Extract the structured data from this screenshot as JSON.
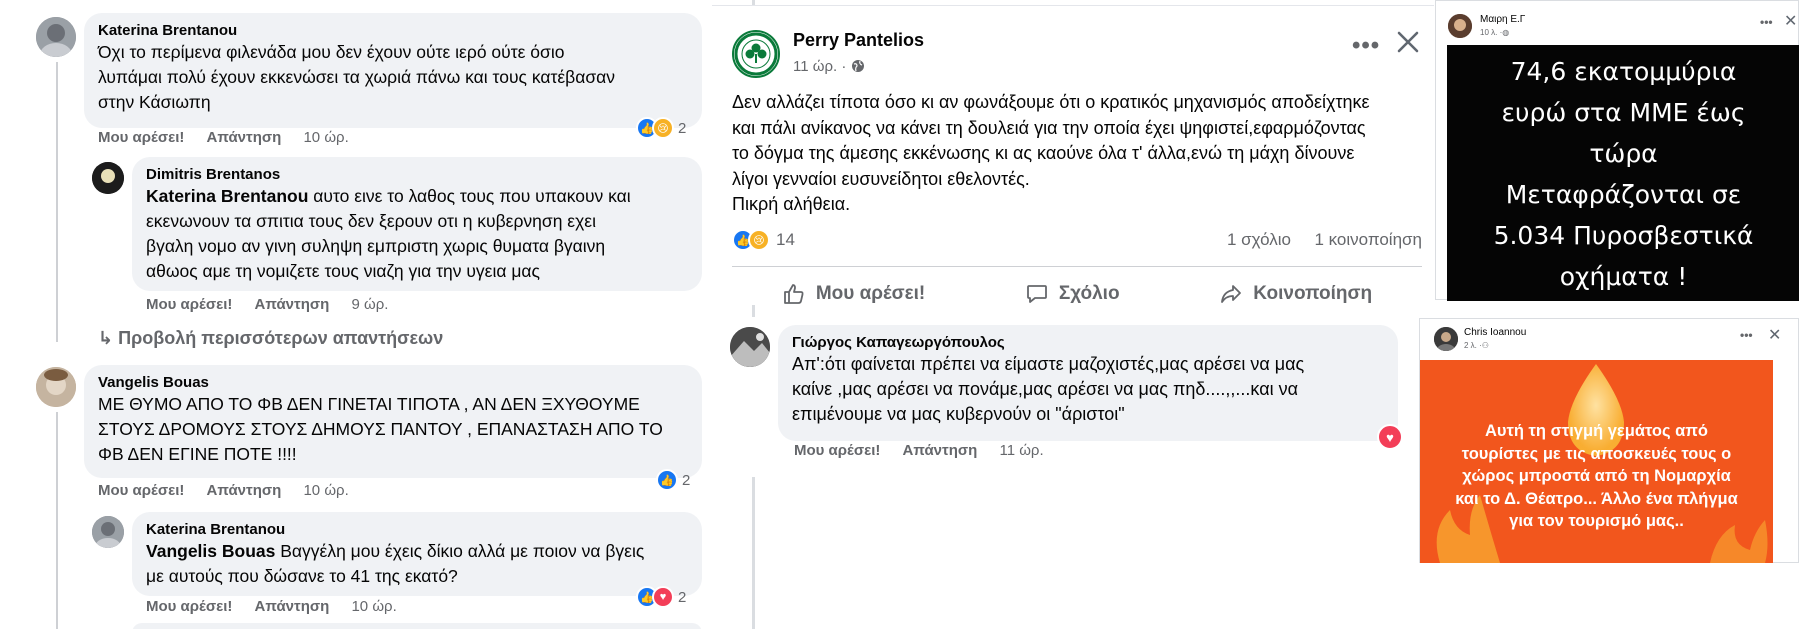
{
  "comments": [
    {
      "name": "Katerina Brentanou",
      "lines": [
        "Όχι το περίμενα φιλενάδα μου δεν έχουν ούτε ιερό ούτε όσιο",
        "λυπάμαι πολύ έχουν εκκενώσει τα χωριά πάνω και τους κατέβασαν",
        "στην Κάσιωπη"
      ],
      "like_label": "Μου αρέσει!",
      "reply_label": "Απάντηση",
      "time": "10 ώρ.",
      "reaction_count": "2"
    },
    {
      "name": "Dimitris Brentanos",
      "tag": "Katerina Brentanou",
      "lines": [
        " αυτο εινε το λαθος τους που υπακουν και",
        "εκενωνουν τα σπιτια τους δεν ξερουν οτι η κυβερνηση εχει",
        "βγαλη νομο αν γινη συληψη εμπριστη χωρις θυματα βγαινη",
        "αθωος αμε τη νομιζετε τους νιαζη για την υγεια μας"
      ],
      "like_label": "Μου αρέσει!",
      "reply_label": "Απάντηση",
      "time": "9 ώρ."
    },
    {
      "name": "Vangelis Bouas",
      "lines": [
        "ΜΕ ΘΥΜΟ ΑΠΟ ΤΟ ΦΒ ΔΕΝ ΓΙΝΕΤΑΙ ΤΙΠΟΤΑ , ΑΝ ΔΕΝ ΞΧΥΘΟΥΜΕ",
        "ΣΤΟΥΣ ΔΡΟΜΟΥΣ ΣΤΟΥΣ ΔΗΜΟΥΣ ΠΑΝΤΟΥ , ΕΠΑΝΑΣΤΑΣΗ ΑΠΟ ΤΟ",
        "ΦΒ ΔΕΝ ΕΓΙΝΕ ΠΟΤΕ !!!!"
      ],
      "like_label": "Μου αρέσει!",
      "reply_label": "Απάντηση",
      "time": "10 ώρ.",
      "reaction_count": "2"
    },
    {
      "name": "Katerina Brentanou",
      "tag": "Vangelis Bouas",
      "lines": [
        " Βαγγέλη μου έχεις δίκιο αλλά με ποιον να βγεις",
        "με αυτούς που δώσανε το 41 της εκατό?"
      ],
      "like_label": "Μου αρέσει!",
      "reply_label": "Απάντηση",
      "time": "10 ώρ.",
      "reaction_count": "2"
    }
  ],
  "more_replies": "Προβολή περισσότερων απαντήσεων",
  "post": {
    "author": "Perry Pantelios",
    "time": "11 ώρ. ·",
    "body_lines": [
      "Δεν αλλάζει τίποτα όσο κι αν φωνάξουμε ότι ο κρατικός μηχανισμός αποδείχτηκε",
      "και πάλι ανίκανος να κάνει τη δουλειά για την οποία έχει ψηφιστεί,εφαρμόζοντας",
      "το δόγμα της άμεσης εκκένωσης κι ας καούνε όλα τ' άλλα,ενώ τη μάχη δίνουνε",
      "λίγοι γενναίοι ευσυνείδητοι εθελοντές.",
      "Πικρή αλήθεια."
    ],
    "reaction_count": "14",
    "comments_count": "1 σχόλιο",
    "shares_count": "1 κοινοποίηση",
    "action_like": "Μου αρέσει!",
    "action_comment": "Σχόλιο",
    "action_share": "Κοινοποίηση"
  },
  "post_comment": {
    "name": "Γιώργος Καπαγεωργόπουλος",
    "lines": [
      "Απ':ότι φαίνεται πρέπει να είμαστε μαζοχιστές,μας αρέσει να μας",
      "καίνε ,μας αρέσει να πονάμε,μας αρέσει να μας πηδ....,,...και να",
      "επιμένουμε να μας κυβερνούν οι \"άριστοι\""
    ],
    "like_label": "Μου αρέσει!",
    "reply_label": "Απάντηση",
    "time": "11 ώρ."
  },
  "story1": {
    "author": "Μαιρη Ε.Γ",
    "time": "10 λ. ·",
    "lines": [
      "74,6 εκατομμύρια",
      "ευρώ στα ΜΜΕ έως",
      "τώρα",
      "Μεταφράζονται σε",
      "5.034 Πυροσβεστικά",
      "οχήματα !"
    ]
  },
  "story2": {
    "author": "Chris Ioannou",
    "time": "2 λ. ·",
    "lines": [
      "Αυτή τη στιγμή γεμάτος από",
      "τουρίστες με τις αποσκευές τους ο",
      "χώρος μπροστά από τη Νομαρχία",
      "και το Δ. Θέατρο... Άλλο ένα πλήγμα",
      "για τον τουρισμό μας.."
    ]
  },
  "colors": {
    "facebook_blue": "#1877f2",
    "love_red": "#f33e58",
    "sad_yellow": "#f7b125",
    "bubble_gray": "#f0f2f5",
    "secondary_text": "#65676b",
    "panathinaikos_green": "#0a7a3a",
    "story2_orange": "#f2561d"
  },
  "icons": [
    "like-icon",
    "sad-icon",
    "love-icon",
    "reply-arrow-icon",
    "globe-icon",
    "more-icon",
    "close-icon",
    "comment-icon",
    "share-icon",
    "club-logo-icon"
  ]
}
